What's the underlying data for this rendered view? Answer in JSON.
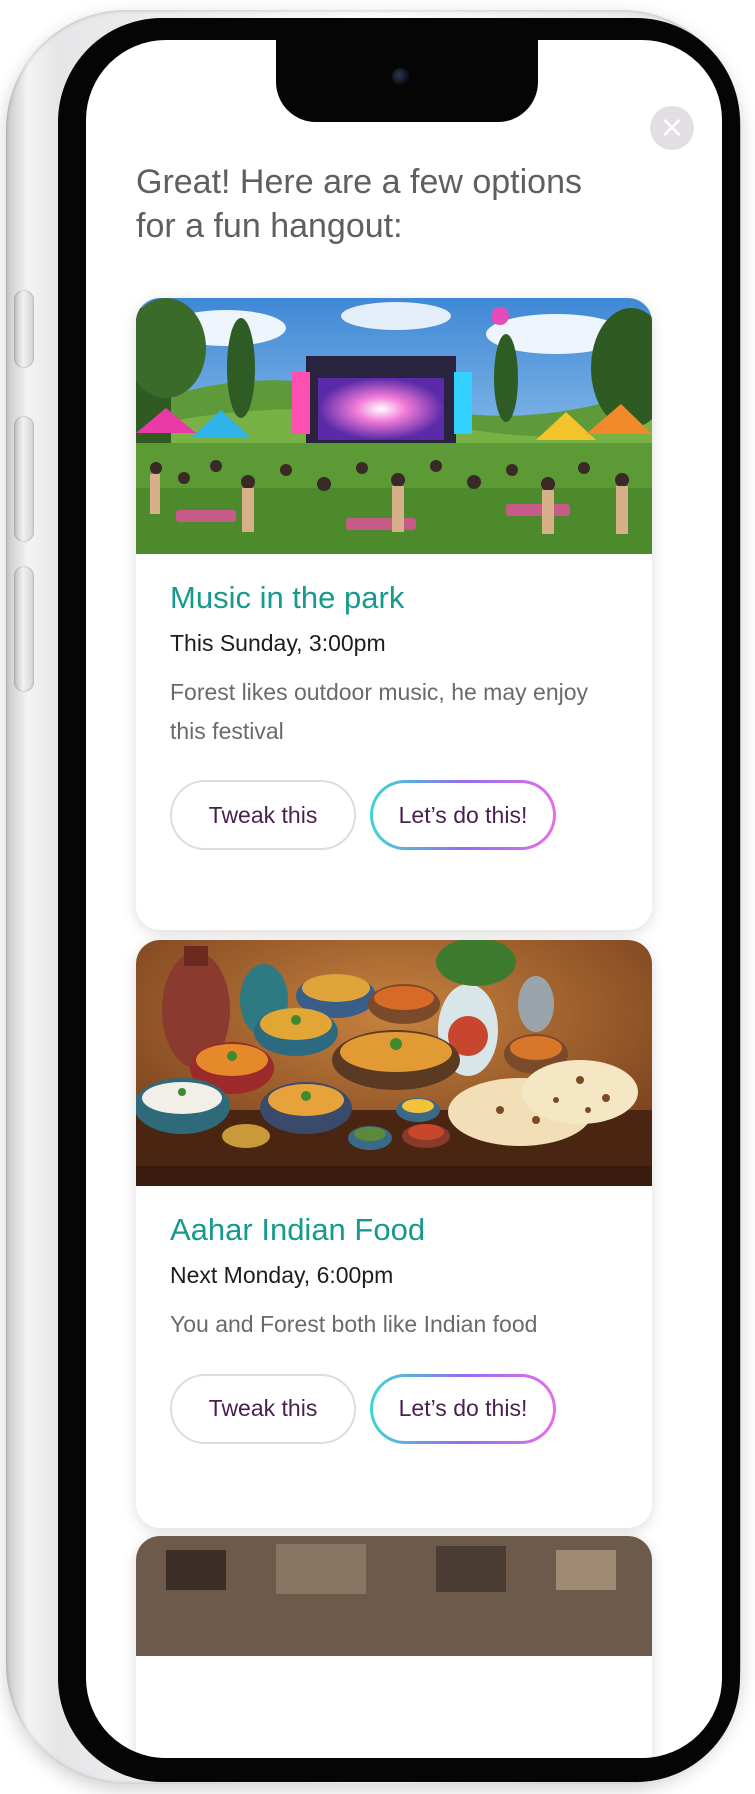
{
  "intro_text": "Great! Here are a few options for a fun hangout:",
  "close_label": "×",
  "cards": [
    {
      "image_label": "Outdoor music festival in a park",
      "title": "Music in the park",
      "when": "This Sunday, 3:00pm",
      "description": "Forest likes outdoor music, he may enjoy this festival",
      "tweak_label": "Tweak this",
      "go_label": "Let’s do this!"
    },
    {
      "image_label": "Table of Indian dishes",
      "title": "Aahar Indian Food",
      "when": "Next Monday, 6:00pm",
      "description": "You and Forest both like Indian food",
      "tweak_label": "Tweak this",
      "go_label": "Let’s do this!"
    }
  ],
  "colors": {
    "accent_teal": "#169a8e",
    "button_text": "#4a1e4f",
    "gradient_start": "#3fd6d0",
    "gradient_end": "#e66ee8",
    "close_bg": "#e5dde6"
  }
}
